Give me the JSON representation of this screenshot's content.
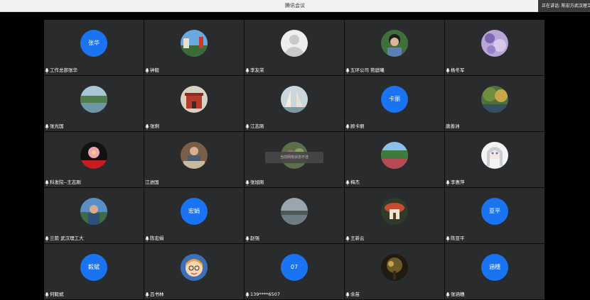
{
  "app": {
    "title": "腾讯会议"
  },
  "status": {
    "speaking": "正在讲话: 陈宏方武汉理工"
  },
  "toast": {
    "text": "当前网络状态不佳"
  },
  "colors": {
    "accent": "#1a73f0",
    "tile_bg": "#2a2b2d",
    "background": "#000000"
  },
  "participants": [
    {
      "name": "工作总部张华",
      "avatar": "initials",
      "initials": "张华",
      "mic": true
    },
    {
      "name": "钟毅",
      "avatar": "photo",
      "photo": "landscape",
      "mic": true
    },
    {
      "name": "李友荣",
      "avatar": "default",
      "mic": true
    },
    {
      "name": "五环公司 熊庭曦",
      "avatar": "photo",
      "photo": "person",
      "mic": true
    },
    {
      "name": "杨冬军",
      "avatar": "photo",
      "photo": "purple-flowers",
      "mic": true
    },
    {
      "name": "张光国",
      "avatar": "photo",
      "photo": "river",
      "mic": true
    },
    {
      "name": "张俐",
      "avatar": "photo",
      "photo": "temple",
      "mic": true
    },
    {
      "name": "江志刚",
      "avatar": "photo",
      "photo": "sails",
      "mic": true
    },
    {
      "name": "顾卡丽",
      "avatar": "initials",
      "initials": "卡丽",
      "mic": true
    },
    {
      "name": "唐善洲",
      "avatar": "photo",
      "photo": "park",
      "mic": false
    },
    {
      "name": "科发院--王志刚",
      "avatar": "photo",
      "photo": "lotus-logo",
      "mic": true
    },
    {
      "name": "江进国",
      "avatar": "photo",
      "photo": "desk",
      "mic": false
    },
    {
      "name": "张旭刚",
      "avatar": "photo",
      "photo": "garden",
      "mic": true
    },
    {
      "name": "梅杰",
      "avatar": "photo",
      "photo": "lake",
      "mic": true
    },
    {
      "name": "李惠萍",
      "avatar": "photo",
      "photo": "anime",
      "mic": true
    },
    {
      "name": "兰箭 武汉理工大",
      "avatar": "photo",
      "photo": "man-outdoor",
      "mic": true
    },
    {
      "name": "陈宏娟",
      "avatar": "initials",
      "initials": "宏娟",
      "mic": true
    },
    {
      "name": "赵强",
      "avatar": "photo",
      "photo": "misty-lake",
      "mic": true
    },
    {
      "name": "王新云",
      "avatar": "photo",
      "photo": "mushroom-house",
      "mic": true
    },
    {
      "name": "陈亚平",
      "avatar": "initials",
      "initials": "亚平",
      "mic": true
    },
    {
      "name": "何毅斌",
      "avatar": "initials",
      "initials": "毅斌",
      "mic": true
    },
    {
      "name": "吕书林",
      "avatar": "photo",
      "photo": "cartoon-face",
      "mic": true
    },
    {
      "name": "139****6507",
      "avatar": "initials",
      "initials": "07",
      "mic": true
    },
    {
      "name": "余苗",
      "avatar": "photo",
      "photo": "dark-tree",
      "mic": true
    },
    {
      "name": "张涵穗",
      "avatar": "initials",
      "initials": "涵穗",
      "mic": true
    }
  ]
}
